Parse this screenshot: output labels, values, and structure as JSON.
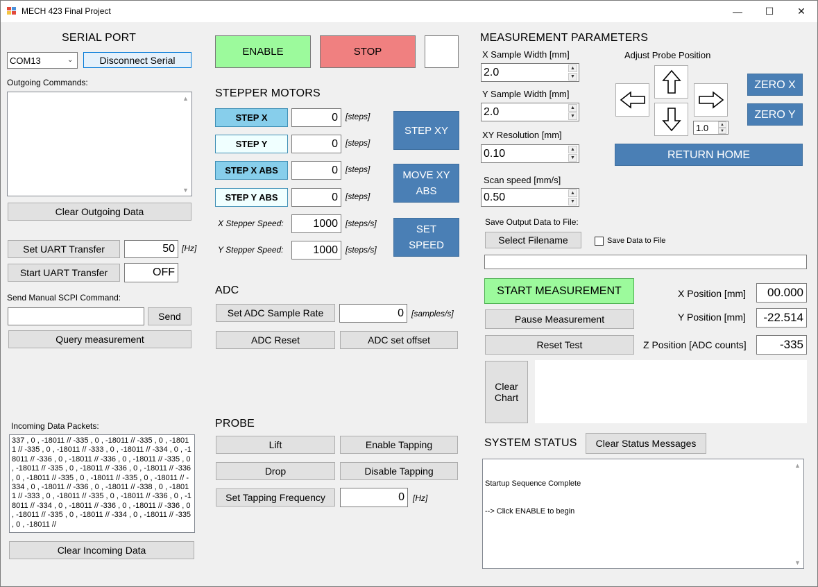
{
  "window": {
    "title": "MECH 423 Final Project",
    "minimize": "—",
    "maximize": "☐",
    "close": "✕"
  },
  "serial": {
    "heading": "SERIAL PORT",
    "port_selected": "COM13",
    "disconnect_label": "Disconnect Serial",
    "outgoing_label": "Outgoing Commands:",
    "outgoing_text": "",
    "clear_outgoing_label": "Clear Outgoing Data",
    "set_uart_label": "Set UART Transfer",
    "uart_rate": "50",
    "uart_unit": "[Hz]",
    "start_uart_label": "Start UART Transfer",
    "uart_state": "OFF",
    "manual_label": "Send Manual SCPI Command:",
    "manual_value": "",
    "send_label": "Send",
    "query_label": "Query measurement",
    "incoming_label": "Incoming Data Packets:",
    "incoming_text": "337 , 0 , -18011 // -335 , 0 , -18011 // -335 , 0 , -18011 // -335 , 0 , -18011 // -333 , 0 , -18011 // -334 , 0 , -18011 // -336 , 0 , -18011 // -336 , 0 , -18011 // -335 , 0 , -18011 // -335 , 0 , -18011 // -336 , 0 , -18011 // -336 , 0 , -18011 // -335 , 0 , -18011 // -335 , 0 , -18011 // -334 , 0 , -18011 // -336 , 0 , -18011 // -338 , 0 , -18011 // -333 , 0 , -18011 // -335 , 0 , -18011 // -336 , 0 , -18011 // -334 , 0 , -18011 // -336 , 0 , -18011 // -336 , 0 , -18011 // -335 , 0 , -18011 // -334 , 0 , -18011 // -335 , 0 , -18011 //",
    "clear_incoming_label": "Clear Incoming Data"
  },
  "controls": {
    "enable_label": "ENABLE",
    "stop_label": "STOP"
  },
  "stepper": {
    "heading": "STEPPER MOTORS",
    "step_x_label": "STEP X",
    "step_x_value": "0",
    "step_y_label": "STEP Y",
    "step_y_value": "0",
    "step_x_abs_label": "STEP X ABS",
    "step_x_abs_value": "0",
    "step_y_abs_label": "STEP Y ABS",
    "step_y_abs_value": "0",
    "steps_unit": "[steps]",
    "x_speed_label": "X Stepper Speed:",
    "x_speed_value": "1000",
    "y_speed_label": "Y Stepper Speed:",
    "y_speed_value": "1000",
    "speed_unit": "[steps/s]",
    "step_xy_label": "STEP XY",
    "move_xy_abs_line1": "MOVE XY",
    "move_xy_abs_line2": "ABS",
    "set_speed_line1": "SET",
    "set_speed_line2": "SPEED"
  },
  "adc": {
    "heading": "ADC",
    "set_rate_label": "Set ADC Sample Rate",
    "rate_value": "0",
    "rate_unit": "[samples/s]",
    "reset_label": "ADC Reset",
    "offset_label": "ADC set offset"
  },
  "probe": {
    "heading": "PROBE",
    "lift_label": "Lift",
    "enable_tapping_label": "Enable Tapping",
    "drop_label": "Drop",
    "disable_tapping_label": "Disable Tapping",
    "set_tap_freq_label": "Set Tapping Frequency",
    "tap_freq_value": "0",
    "tap_freq_unit": "[Hz]"
  },
  "measurement": {
    "heading": "MEASUREMENT PARAMETERS",
    "x_width_label": "X Sample Width [mm]",
    "x_width_value": "2.0",
    "y_width_label": "Y Sample Width [mm]",
    "y_width_value": "2.0",
    "xy_res_label": "XY Resolution [mm]",
    "xy_res_value": "0.10",
    "scan_speed_label": "Scan speed [mm/s]",
    "scan_speed_value": "0.50",
    "adjust_label": "Adjust Probe Position",
    "step_size_value": "1.0",
    "zero_x_label": "ZERO X",
    "zero_y_label": "ZERO Y",
    "return_home_label": "RETURN HOME",
    "save_label": "Save Output Data to File:",
    "select_filename_label": "Select Filename",
    "save_checkbox_label": "Save Data to File",
    "filename_value": "",
    "start_label": "START MEASUREMENT",
    "pause_label": "Pause Measurement",
    "reset_test_label": "Reset Test",
    "x_pos_label": "X Position [mm]",
    "x_pos_value": "00.000",
    "y_pos_label": "Y Position [mm]",
    "y_pos_value": "-22.514",
    "z_pos_label": "Z Position [ADC counts]",
    "z_pos_value": "-335",
    "clear_chart_line1": "Clear",
    "clear_chart_line2": "Chart"
  },
  "status": {
    "heading": "SYSTEM STATUS",
    "clear_label": "Clear Status Messages",
    "line1": "Startup Sequence Complete",
    "line2": "--> Click ENABLE to begin"
  },
  "colors": {
    "green": "#9cfa9c",
    "red": "#f08080",
    "blue": "#4a7fb5",
    "light_blue": "#87ceeb",
    "light_cyan": "#f0ffff"
  }
}
